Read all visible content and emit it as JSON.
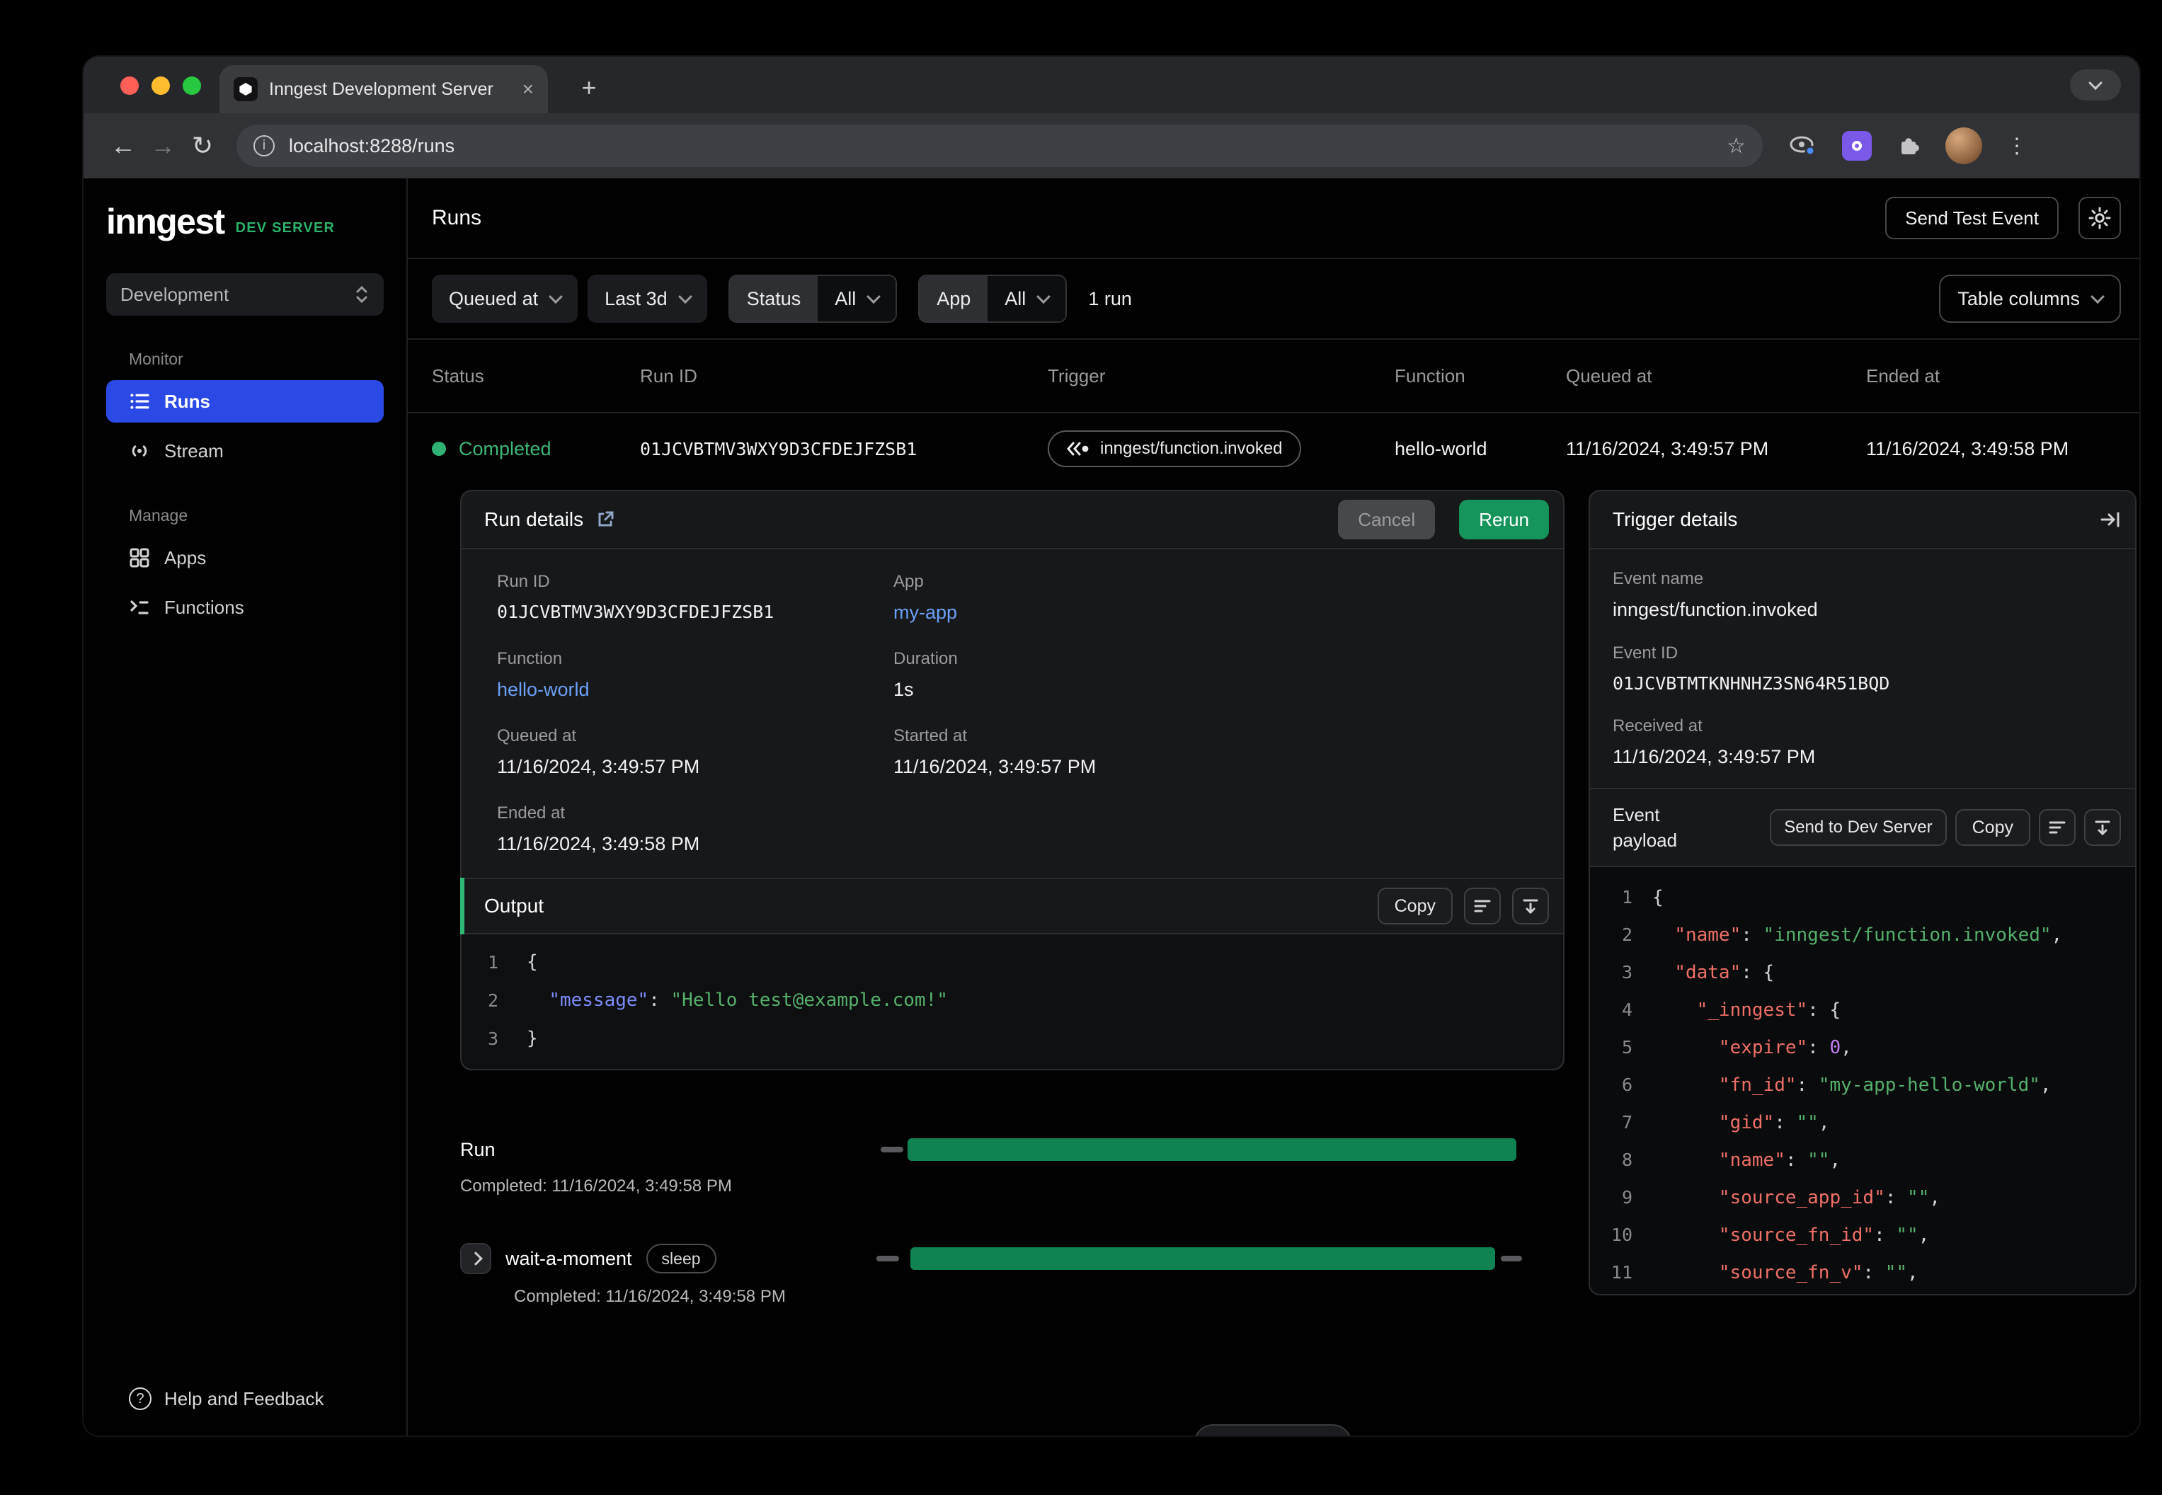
{
  "browser": {
    "tab_title": "Inngest Development Server",
    "url": "localhost:8288/runs"
  },
  "sidebar": {
    "logo": "inngest",
    "badge": "DEV SERVER",
    "env": "Development",
    "monitor_label": "Monitor",
    "manage_label": "Manage",
    "runs": "Runs",
    "stream": "Stream",
    "apps": "Apps",
    "functions": "Functions",
    "help": "Help and Feedback"
  },
  "header": {
    "title": "Runs",
    "send_test_event": "Send Test Event"
  },
  "filters": {
    "queued_at": "Queued at",
    "range": "Last 3d",
    "status_label": "Status",
    "status_value": "All",
    "app_label": "App",
    "app_value": "All",
    "count": "1 run",
    "table_columns": "Table columns"
  },
  "table": {
    "columns": [
      "Status",
      "Run ID",
      "Trigger",
      "Function",
      "Queued at",
      "Ended at"
    ],
    "row": {
      "status": "Completed",
      "run_id": "01JCVBTMV3WXY9D3CFDEJFZSB1",
      "trigger": "inngest/function.invoked",
      "function": "hello-world",
      "queued_at": "11/16/2024, 3:49:57 PM",
      "ended_at": "11/16/2024, 3:49:58 PM"
    }
  },
  "run_details": {
    "title": "Run details",
    "cancel": "Cancel",
    "rerun": "Rerun",
    "run_id_label": "Run ID",
    "run_id": "01JCVBTMV3WXY9D3CFDEJFZSB1",
    "app_label": "App",
    "app": "my-app",
    "function_label": "Function",
    "function": "hello-world",
    "duration_label": "Duration",
    "duration": "1s",
    "queued_label": "Queued at",
    "queued": "11/16/2024, 3:49:57 PM",
    "started_label": "Started at",
    "started": "11/16/2024, 3:49:57 PM",
    "ended_label": "Ended at",
    "ended": "11/16/2024, 3:49:58 PM",
    "output": {
      "title": "Output",
      "copy": "Copy",
      "lines": [
        [
          [
            "{",
            "p"
          ]
        ],
        [
          [
            "  ",
            "p"
          ],
          [
            "\"message\"",
            "kb"
          ],
          [
            ": ",
            "p"
          ],
          [
            "\"Hello test@example.com!\"",
            "s"
          ]
        ],
        [
          [
            "}",
            "p"
          ]
        ]
      ]
    }
  },
  "timeline": {
    "run_label": "Run",
    "run_completed": "Completed: 11/16/2024, 3:49:58 PM",
    "step_name": "wait-a-moment",
    "step_kind": "sleep",
    "step_completed": "Completed: 11/16/2024, 3:49:58 PM"
  },
  "trigger": {
    "title": "Trigger details",
    "event_name_label": "Event name",
    "event_name": "inngest/function.invoked",
    "event_id_label": "Event ID",
    "event_id": "01JCVBTMTKNHNHZ3SN64R51BQD",
    "received_label": "Received at",
    "received": "11/16/2024, 3:49:57 PM",
    "payload": {
      "label": "Event payload",
      "send": "Send to Dev Server",
      "copy": "Copy",
      "lines": [
        [
          [
            "{",
            "p"
          ]
        ],
        [
          [
            "  ",
            "p"
          ],
          [
            "\"name\"",
            "k"
          ],
          [
            ": ",
            "p"
          ],
          [
            "\"inngest/function.invoked\"",
            "s"
          ],
          [
            ",",
            "p"
          ]
        ],
        [
          [
            "  ",
            "p"
          ],
          [
            "\"data\"",
            "k"
          ],
          [
            ": {",
            "p"
          ]
        ],
        [
          [
            "    ",
            "p"
          ],
          [
            "\"_inngest\"",
            "k"
          ],
          [
            ": {",
            "p"
          ]
        ],
        [
          [
            "      ",
            "p"
          ],
          [
            "\"expire\"",
            "k"
          ],
          [
            ": ",
            "p"
          ],
          [
            "0",
            "n"
          ],
          [
            ",",
            "p"
          ]
        ],
        [
          [
            "      ",
            "p"
          ],
          [
            "\"fn_id\"",
            "k"
          ],
          [
            ": ",
            "p"
          ],
          [
            "\"my-app-hello-world\"",
            "s"
          ],
          [
            ",",
            "p"
          ]
        ],
        [
          [
            "      ",
            "p"
          ],
          [
            "\"gid\"",
            "k"
          ],
          [
            ": ",
            "p"
          ],
          [
            "\"\"",
            "s"
          ],
          [
            ",",
            "p"
          ]
        ],
        [
          [
            "      ",
            "p"
          ],
          [
            "\"name\"",
            "k"
          ],
          [
            ": ",
            "p"
          ],
          [
            "\"\"",
            "s"
          ],
          [
            ",",
            "p"
          ]
        ],
        [
          [
            "      ",
            "p"
          ],
          [
            "\"source_app_id\"",
            "k"
          ],
          [
            ": ",
            "p"
          ],
          [
            "\"\"",
            "s"
          ],
          [
            ",",
            "p"
          ]
        ],
        [
          [
            "      ",
            "p"
          ],
          [
            "\"source_fn_id\"",
            "k"
          ],
          [
            ": ",
            "p"
          ],
          [
            "\"\"",
            "s"
          ],
          [
            ",",
            "p"
          ]
        ],
        [
          [
            "      ",
            "p"
          ],
          [
            "\"source_fn_v\"",
            "k"
          ],
          [
            ": ",
            "p"
          ],
          [
            "\"\"",
            "s"
          ],
          [
            ",",
            "p"
          ]
        ]
      ]
    }
  },
  "colors": {
    "accent_blue": "#2b49e4",
    "brand_green": "#2cb36b",
    "status_green": "#2fb274",
    "rerun_green": "#15945b",
    "timeline_green": "#118352",
    "link_blue": "#6ba0f6"
  }
}
